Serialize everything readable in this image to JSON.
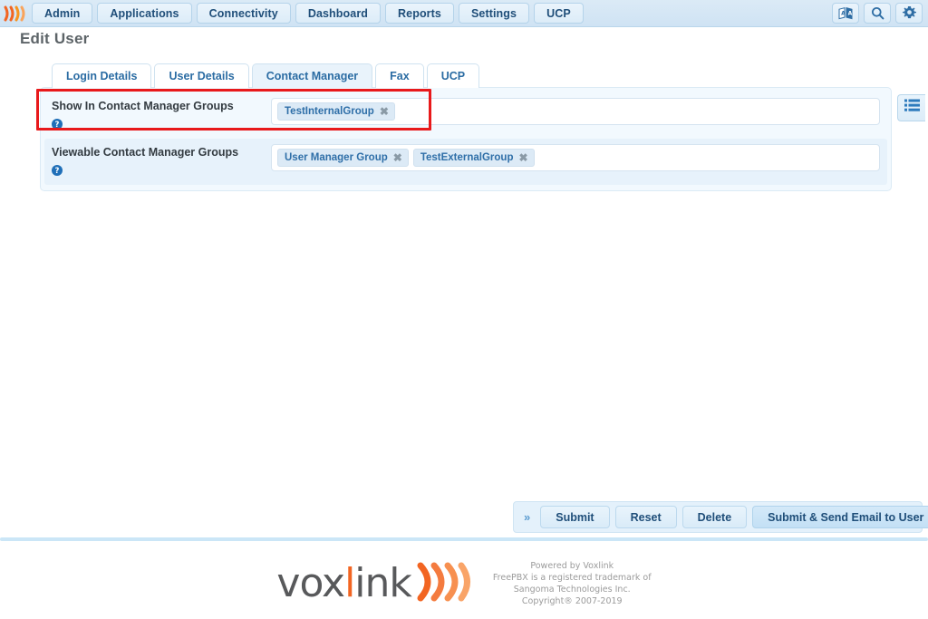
{
  "navbar": {
    "logo_icon": "voxlink-waves-logo",
    "items": [
      {
        "label": "Admin",
        "name": "nav-admin"
      },
      {
        "label": "Applications",
        "name": "nav-applications"
      },
      {
        "label": "Connectivity",
        "name": "nav-connectivity"
      },
      {
        "label": "Dashboard",
        "name": "nav-dashboard"
      },
      {
        "label": "Reports",
        "name": "nav-reports"
      },
      {
        "label": "Settings",
        "name": "nav-settings"
      },
      {
        "label": "UCP",
        "name": "nav-ucp"
      }
    ],
    "right_icons": [
      {
        "icon": "translate-icon",
        "name": "nav-translate-button"
      },
      {
        "icon": "search-icon",
        "name": "nav-search-button"
      },
      {
        "icon": "gear-icon",
        "name": "nav-settings-button"
      }
    ]
  },
  "page": {
    "title": "Edit User"
  },
  "tabs": [
    {
      "label": "Login Details",
      "active": false
    },
    {
      "label": "User Details",
      "active": false
    },
    {
      "label": "Contact Manager",
      "active": true
    },
    {
      "label": "Fax",
      "active": false
    },
    {
      "label": "UCP",
      "active": false
    }
  ],
  "form": {
    "rows": [
      {
        "label": "Show In Contact Manager Groups",
        "help_icon": "help-circle-icon",
        "highlighted": true,
        "chips": [
          {
            "label": "TestInternalGroup",
            "remove": "✖"
          }
        ]
      },
      {
        "label": "Viewable Contact Manager Groups",
        "help_icon": "help-circle-icon",
        "highlighted": false,
        "chips": [
          {
            "label": "User Manager Group",
            "remove": "✖"
          },
          {
            "label": "TestExternalGroup",
            "remove": "✖"
          }
        ]
      }
    ],
    "side_toggle_icon": "list-view-icon"
  },
  "actions": {
    "chevron": "»",
    "buttons": [
      {
        "label": "Submit",
        "name": "submit-button",
        "primary": false
      },
      {
        "label": "Reset",
        "name": "reset-button",
        "primary": false
      },
      {
        "label": "Delete",
        "name": "delete-button",
        "primary": false
      },
      {
        "label": "Submit & Send Email to User",
        "name": "submit-send-email-button",
        "primary": true
      }
    ]
  },
  "footer": {
    "logo_text_part1": "vox",
    "logo_text_i": "l",
    "logo_text_part2": "ink",
    "lines": [
      "Powered by Voxlink",
      "FreePBX is a registered trademark of",
      "Sangoma Technologies Inc.",
      "Copyright® 2007-2019"
    ]
  },
  "colors": {
    "nav_bg": "#cfe3f4",
    "accent_blue": "#2b6ca3",
    "highlight_red": "#e8191b",
    "brand_orange": "#f26522",
    "panel_bg": "#f2f9fe"
  }
}
